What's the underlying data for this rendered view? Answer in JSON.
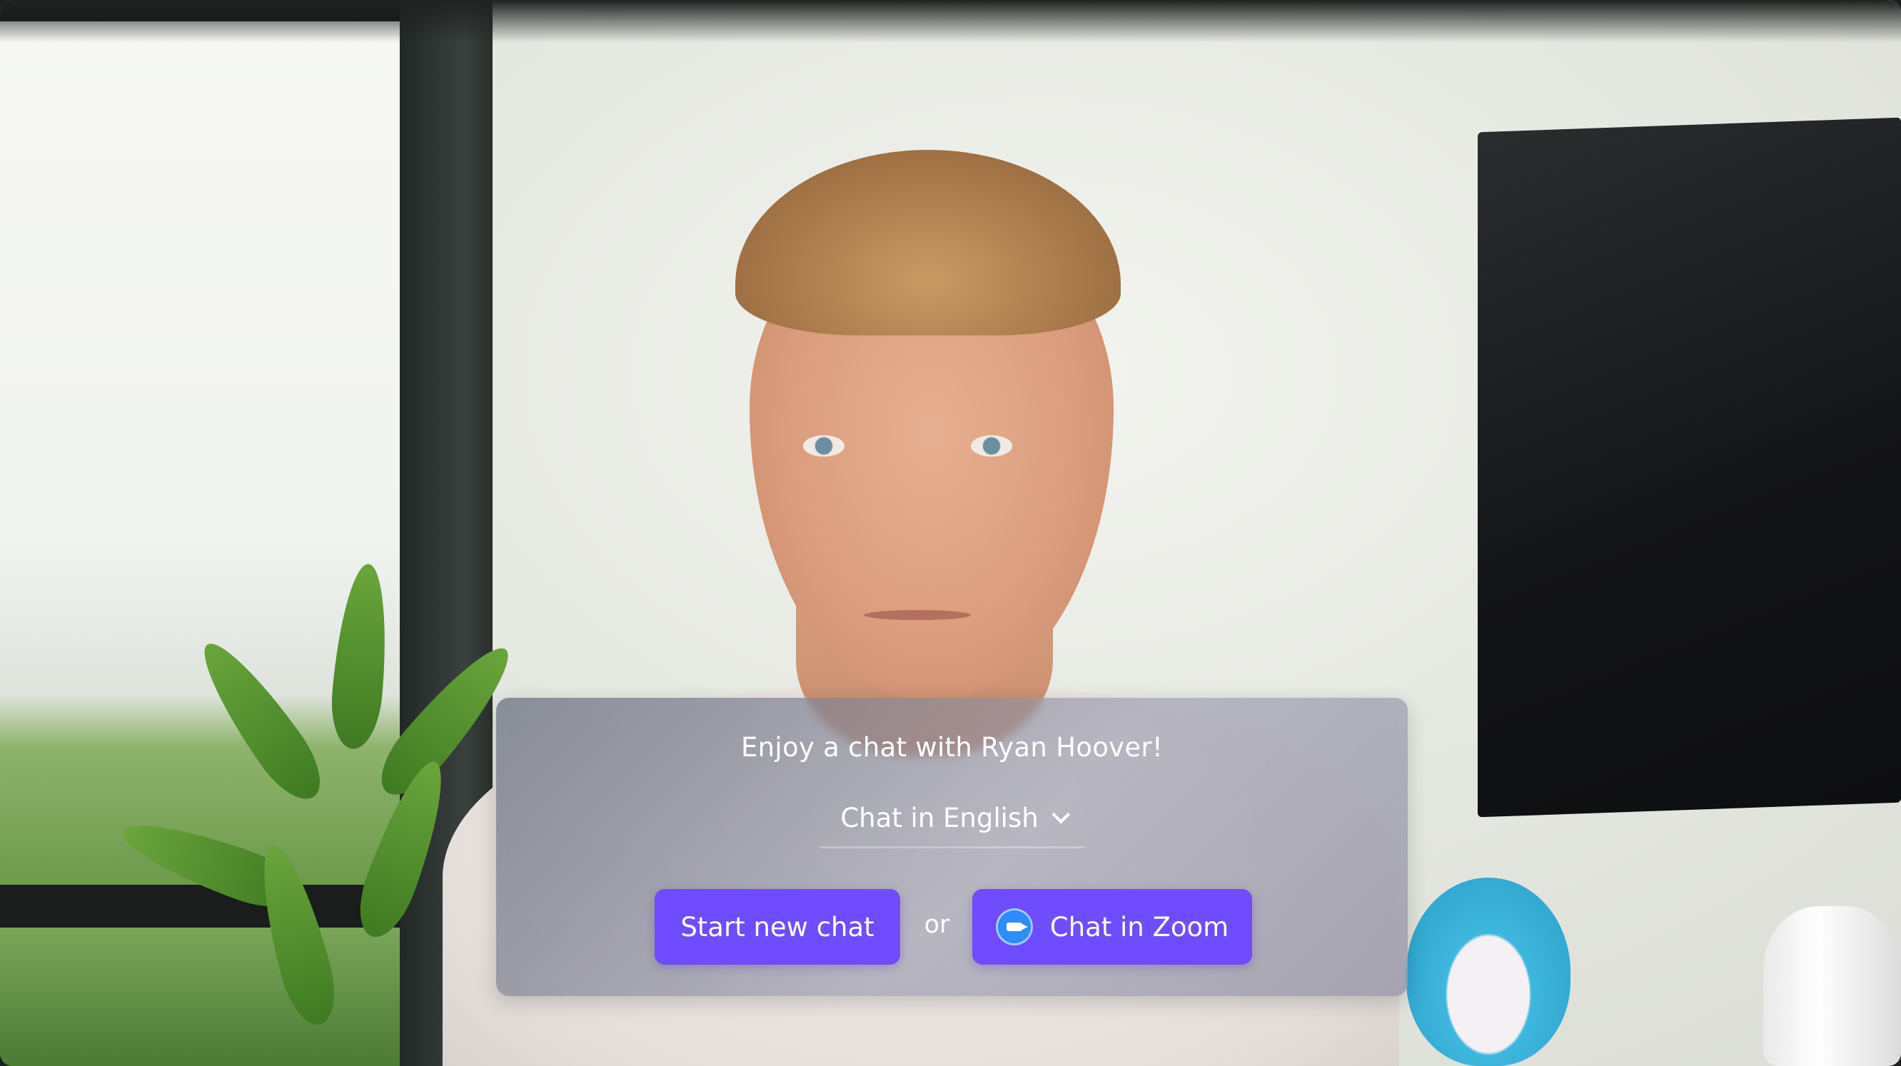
{
  "chat_widget": {
    "title": "Enjoy a chat with Ryan Hoover!",
    "language_select": {
      "selected": "Chat in English",
      "icon": "chevron-down-icon"
    },
    "start_button_label": "Start new chat",
    "separator_text": "or",
    "zoom_button": {
      "label": "Chat in Zoom",
      "icon": "zoom-logo-icon"
    },
    "accent_color": "#6f4cff"
  }
}
